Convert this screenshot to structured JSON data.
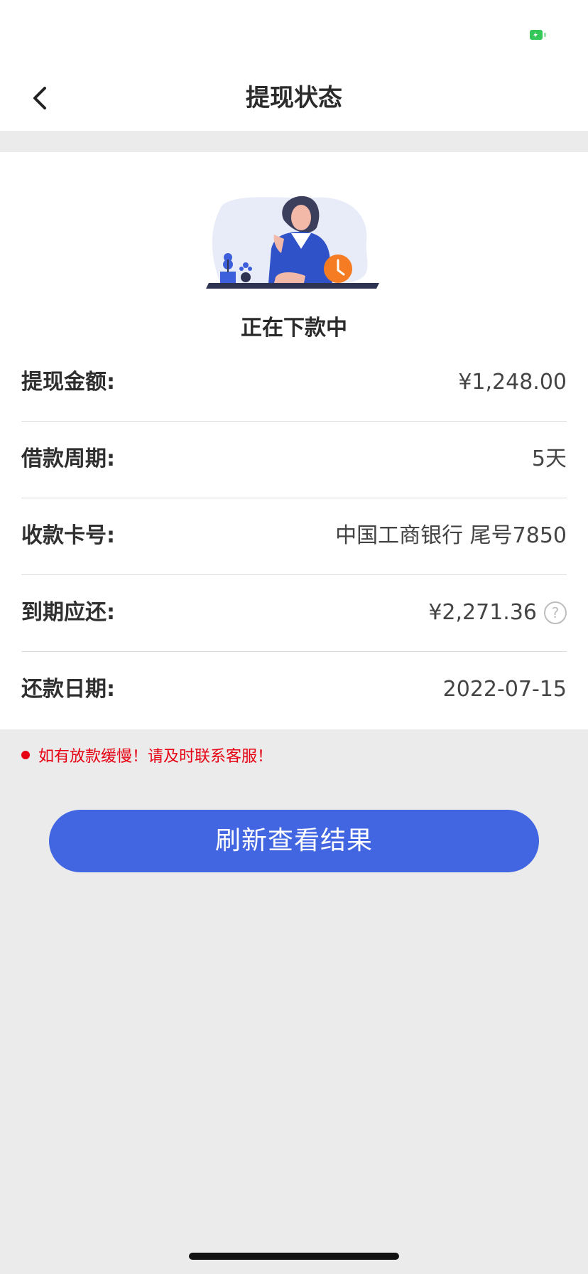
{
  "nav": {
    "title": "提现状态"
  },
  "status": {
    "text": "正在下款中"
  },
  "details": [
    {
      "label": "提现金额:",
      "value": "¥1,248.00"
    },
    {
      "label": "借款周期:",
      "value": "5天"
    },
    {
      "label": "收款卡号:",
      "value": "中国工商银行 尾号7850"
    },
    {
      "label": "到期应还:",
      "value": "¥2,271.36"
    },
    {
      "label": "还款日期:",
      "value": "2022-07-15"
    }
  ],
  "help_icon": {
    "symbol": "?"
  },
  "notice": {
    "text": "如有放款缓慢！请及时联系客服！"
  },
  "button": {
    "label": "刷新查看结果"
  },
  "colors": {
    "accent": "#4266e2",
    "warning": "#e60012",
    "battery": "#34c759"
  },
  "icons": [
    "battery-icon",
    "back-chevron-icon",
    "help-question-icon",
    "status-illustration"
  ]
}
